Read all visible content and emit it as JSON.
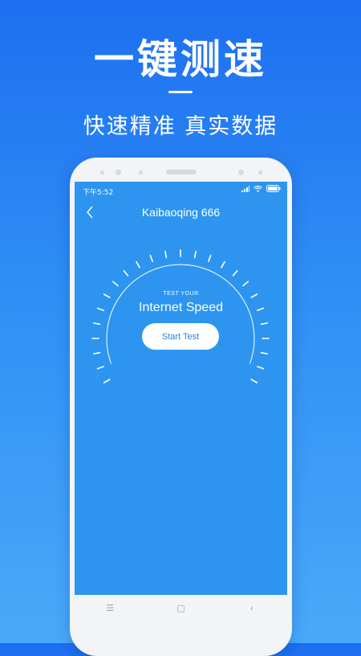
{
  "promo": {
    "headline": "一键测速",
    "subline": "快速精准 真实数据"
  },
  "status_bar": {
    "time": "下午5:52",
    "icons": [
      "signal-icon",
      "wifi-icon",
      "battery-icon"
    ]
  },
  "app": {
    "title": "Kaibaoqing 666",
    "back_icon": "chevron-left-icon"
  },
  "speed_test": {
    "small_label": "TEST YOUR",
    "big_label": "Internet Speed",
    "start_button": "Start Test"
  },
  "nav_bar": {
    "menu": "☰",
    "home": "▢",
    "back": "‹"
  },
  "colors": {
    "background_top": "#1d6ff0",
    "background_bottom": "#49a9f9",
    "screen": "#2d95f0",
    "button_text": "#2a7fd6"
  }
}
